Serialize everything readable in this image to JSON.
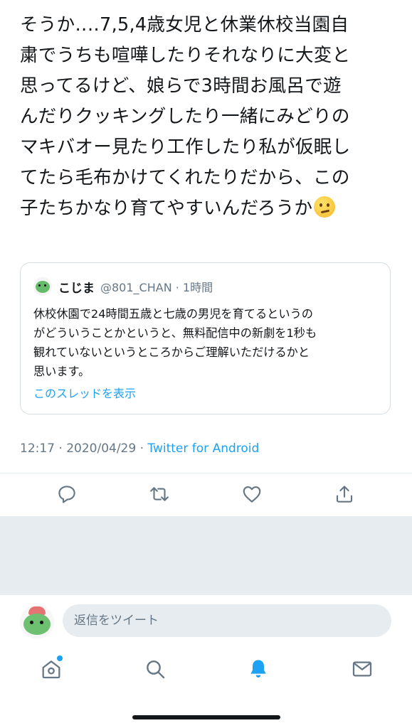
{
  "tweet": {
    "text_lines": [
      "そうか‥‥7,5,4歳女児と休業休校当園自",
      "粛でうちも喧嘩したりそれなりに大変と",
      "思ってるけど、娘らで3時間お風呂で遊",
      "んだりクッキングしたり一緒にみどりの",
      "マキバオー見たり工作したり私が仮眠し",
      "てたら毛布かけてくれたりだから、この",
      "子たちかなり育てやすいんだろうか"
    ],
    "emoji": "thinking-face"
  },
  "quote": {
    "name": "こじま",
    "handle_time": "@801_CHAN · 1時間",
    "body_lines": [
      "休校休園で24時間五歳と七歳の男児を育てるというの",
      "がどういうことかというと、無料配信中の新劇を1秒も",
      "観れていないというところからご理解いただけるかと",
      "思います。"
    ],
    "show_thread": "このスレッドを表示"
  },
  "meta": {
    "time_date": "12:17 · 2020/04/29 · ",
    "source": "Twitter for Android"
  },
  "actions": {
    "reply_icon": "reply-icon",
    "retweet_icon": "retweet-icon",
    "like_icon": "heart-icon",
    "share_icon": "share-icon"
  },
  "reply": {
    "placeholder": "返信をツイート"
  },
  "tabs": {
    "home": "home-icon",
    "search": "search-icon",
    "notifications": "bell-icon",
    "messages": "mail-icon"
  },
  "colors": {
    "accent": "#1da1f2",
    "secondary_text": "#657786",
    "divider": "#e6ecf0"
  }
}
